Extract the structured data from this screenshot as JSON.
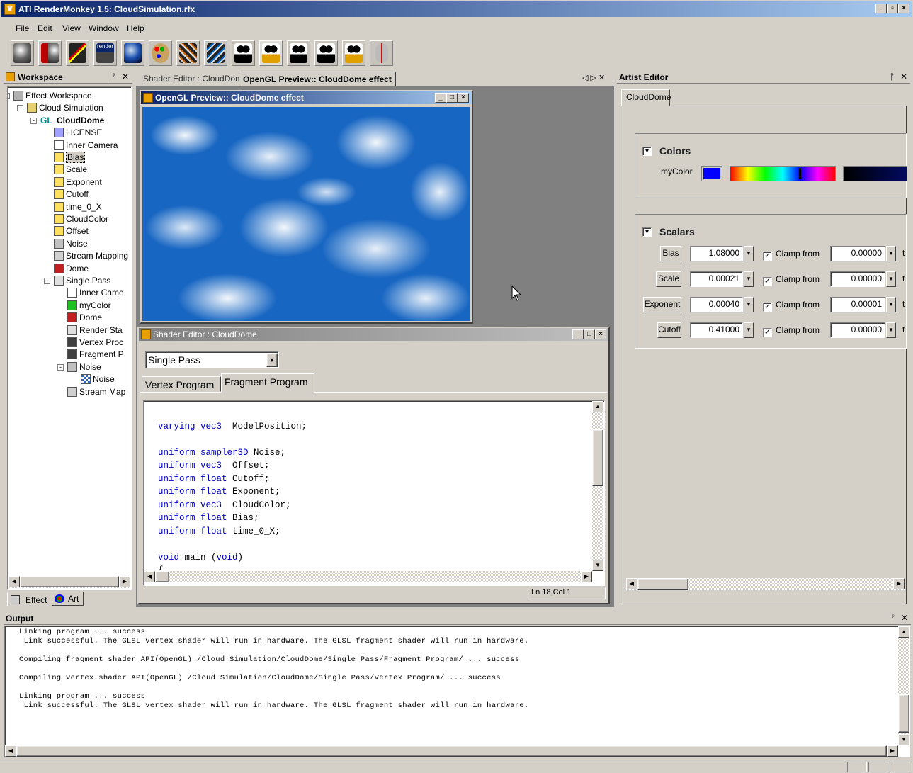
{
  "window": {
    "title": "ATI RenderMonkey 1.5: CloudSimulation.rfx"
  },
  "menu": [
    {
      "label": "File"
    },
    {
      "label": "Edit"
    },
    {
      "label": "View"
    },
    {
      "label": "Window"
    },
    {
      "label": "Help"
    }
  ],
  "toolbar": [
    {
      "icon": "sphere-icon"
    },
    {
      "icon": "ati-sphere-icon"
    },
    {
      "icon": "pencil-icon"
    },
    {
      "icon": "render-icon",
      "text": "render"
    },
    {
      "icon": "blue-orb-icon"
    },
    {
      "icon": "palette-icon"
    },
    {
      "icon": "dice-icon"
    },
    {
      "icon": "dice-icon-2"
    },
    {
      "icon": "camera-icon"
    },
    {
      "icon": "camera-icon-2"
    },
    {
      "icon": "camera-icon-3"
    },
    {
      "icon": "camera-icon-4"
    },
    {
      "icon": "camera-icon-5"
    },
    {
      "icon": "mouse-icon"
    }
  ],
  "workspace": {
    "title": "Workspace",
    "pin": "ᚡ",
    "close": "✕",
    "tree": [
      {
        "label": "Effect Workspace",
        "indent": 0,
        "icon": "workspace-icon",
        "exp": "-"
      },
      {
        "label": "Cloud Simulation",
        "indent": 1,
        "icon": "folder-icon",
        "exp": "-"
      },
      {
        "label": "CloudDome",
        "indent": 2,
        "icon": "gl-icon",
        "exp": "-",
        "bold": true,
        "prefix": "GL"
      },
      {
        "label": "LICENSE",
        "indent": 3,
        "icon": "text-icon"
      },
      {
        "label": "Inner Camera",
        "indent": 3,
        "icon": "camera-icon"
      },
      {
        "label": "Bias",
        "indent": 3,
        "icon": "variable-icon",
        "selected": true
      },
      {
        "label": "Scale",
        "indent": 3,
        "icon": "variable-icon"
      },
      {
        "label": "Exponent",
        "indent": 3,
        "icon": "variable-icon"
      },
      {
        "label": "Cutoff",
        "indent": 3,
        "icon": "variable-icon"
      },
      {
        "label": "time_0_X",
        "indent": 3,
        "icon": "variable-icon"
      },
      {
        "label": "CloudColor",
        "indent": 3,
        "icon": "variable-icon"
      },
      {
        "label": "Offset",
        "indent": 3,
        "icon": "variable-icon"
      },
      {
        "label": "Noise",
        "indent": 3,
        "icon": "texture-icon"
      },
      {
        "label": "Stream Mapping",
        "indent": 3,
        "icon": "stream-icon"
      },
      {
        "label": "Dome",
        "indent": 3,
        "icon": "model-icon"
      },
      {
        "label": "Single Pass",
        "indent": 3,
        "icon": "pass-icon",
        "exp": "-"
      },
      {
        "label": "Inner Came",
        "indent": 4,
        "icon": "camera-icon"
      },
      {
        "label": "myColor",
        "indent": 4,
        "icon": "color-icon"
      },
      {
        "label": "Dome",
        "indent": 4,
        "icon": "model-icon"
      },
      {
        "label": "Render Sta",
        "indent": 4,
        "icon": "flag-icon"
      },
      {
        "label": "Vertex Proc",
        "indent": 4,
        "icon": "shader-icon"
      },
      {
        "label": "Fragment P",
        "indent": 4,
        "icon": "shader-icon"
      },
      {
        "label": "Noise",
        "indent": 4,
        "icon": "texture-icon",
        "exp": "-"
      },
      {
        "label": "Noise",
        "indent": 5,
        "icon": "checker-icon"
      },
      {
        "label": "Stream Map",
        "indent": 4,
        "icon": "stream-icon"
      }
    ],
    "tabs": [
      {
        "label": "Effect"
      },
      {
        "label": "Art"
      }
    ]
  },
  "center": {
    "tabs": [
      {
        "label": "Shader Editor : CloudDome"
      },
      {
        "label": "OpenGL Preview:: CloudDome effect"
      }
    ],
    "nav": "◁ ▷ ✕",
    "preview": {
      "title": "OpenGL Preview:: CloudDome effect"
    },
    "shader": {
      "title": "Shader Editor : CloudDome",
      "pass": "Single Pass",
      "tabs": [
        {
          "label": "Vertex Program"
        },
        {
          "label": "Fragment Program"
        }
      ],
      "code": [
        {
          "kw": "",
          "rest": ""
        },
        {
          "kw": "varying vec3",
          "rest": "  ModelPosition;"
        },
        {
          "kw": "",
          "rest": ""
        },
        {
          "kw": "uniform sampler3D",
          "rest": " Noise;"
        },
        {
          "kw": "uniform vec3",
          "rest": "  Offset;"
        },
        {
          "kw": "uniform float",
          "rest": " Cutoff;"
        },
        {
          "kw": "uniform float",
          "rest": " Exponent;"
        },
        {
          "kw": "uniform vec3",
          "rest": "  CloudColor;"
        },
        {
          "kw": "uniform float",
          "rest": " Bias;"
        },
        {
          "kw": "uniform float",
          "rest": " time_0_X;"
        },
        {
          "kw": "",
          "rest": ""
        },
        {
          "kw": "void",
          "rest": " main (",
          "kw2": "void",
          "rest2": ")"
        },
        {
          "kw": "",
          "rest": "{"
        }
      ],
      "status": "Ln 18,Col 1"
    }
  },
  "artist": {
    "title": "Artist Editor",
    "tab": "CloudDome",
    "colors": {
      "label": "Colors",
      "var": "myColor",
      "swatch": "#0000ff"
    },
    "scalars": {
      "label": "Scalars",
      "rows": [
        {
          "name": "Bias",
          "value": "1.08000",
          "clamp": "Clamp from",
          "from": "0.00000",
          "to": "t"
        },
        {
          "name": "Scale",
          "value": "0.00021",
          "clamp": "Clamp from",
          "from": "0.00000",
          "to": "t"
        },
        {
          "name": "Exponent",
          "value": "0.00040",
          "clamp": "Clamp from",
          "from": "0.00001",
          "to": "t"
        },
        {
          "name": "Cutoff",
          "value": "0.41000",
          "clamp": "Clamp from",
          "from": "0.00000",
          "to": "t"
        }
      ]
    }
  },
  "output": {
    "title": "Output",
    "lines": [
      "Linking program ... success",
      " Link successful. The GLSL vertex shader will run in hardware. The GLSL fragment shader will run in hardware.",
      "",
      "Compiling fragment shader API(OpenGL) /Cloud Simulation/CloudDome/Single Pass/Fragment Program/ ... success",
      "",
      "Compiling vertex shader API(OpenGL) /Cloud Simulation/CloudDome/Single Pass/Vertex Program/ ... success",
      "",
      "Linking program ... success",
      " Link successful. The GLSL vertex shader will run in hardware. The GLSL fragment shader will run in hardware."
    ]
  }
}
